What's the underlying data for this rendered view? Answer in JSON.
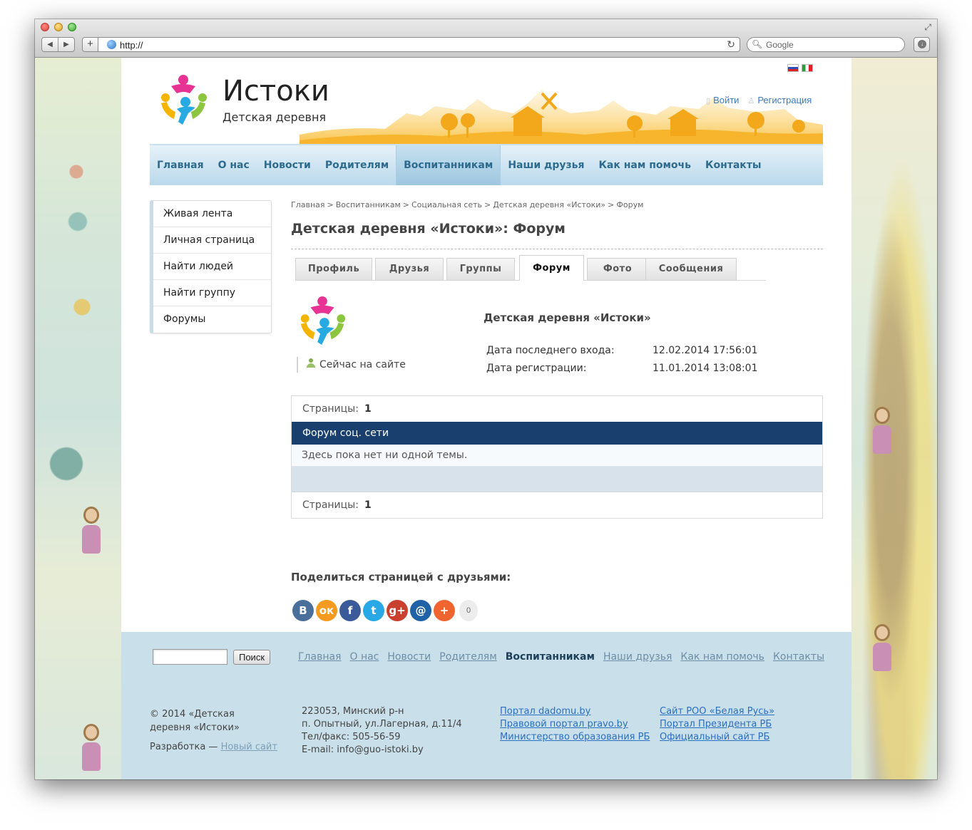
{
  "browser": {
    "url": "http://",
    "search_placeholder": "Google"
  },
  "colors": {
    "nav_text": "#2d6b8f",
    "forum_header_bg": "#183f6d",
    "footer_bg": "#c9dfe9",
    "link": "#2a6fc0"
  },
  "header": {
    "site_name": "Истоки",
    "tagline": "Детская деревня",
    "login": "Войти",
    "register": "Регистрация",
    "languages": [
      "ru",
      "it"
    ]
  },
  "nav": [
    {
      "label": "Главная"
    },
    {
      "label": "О нас"
    },
    {
      "label": "Новости"
    },
    {
      "label": "Родителям"
    },
    {
      "label": "Воспитанникам"
    },
    {
      "label": "Наши друзья"
    },
    {
      "label": "Как нам помочь"
    },
    {
      "label": "Контакты"
    }
  ],
  "nav_active": "Воспитанникам",
  "sidebar": [
    {
      "label": "Живая лента"
    },
    {
      "label": "Личная страница"
    },
    {
      "label": "Найти людей"
    },
    {
      "label": "Найти группу"
    },
    {
      "label": "Форумы"
    }
  ],
  "breadcrumb": [
    "Главная",
    "Воспитанникам",
    "Социальная сеть",
    "Детская деревня «Истоки»",
    "Форум"
  ],
  "breadcrumb_sep": ">",
  "page_title": "Детская деревня «Истоки»: Форум",
  "tabs": [
    {
      "label": "Профиль"
    },
    {
      "label": "Друзья"
    },
    {
      "label": "Группы"
    },
    {
      "label": "Форум"
    },
    {
      "label": "Фото"
    },
    {
      "label": "Сообщения"
    }
  ],
  "tab_active": "Форум",
  "profile": {
    "name": "Детская деревня «Истоки»",
    "online": "Сейчас на сайте",
    "last_login_label": "Дата последнего входа:",
    "last_login_value": "12.02.2014 17:56:01",
    "reg_label": "Дата регистрации:",
    "reg_value": "11.01.2014 13:08:01"
  },
  "forum": {
    "pages_label": "Страницы:",
    "page_number": "1",
    "title": "Форум соц. сети",
    "empty": "Здесь пока нет ни одной темы."
  },
  "share": {
    "title": "Поделиться страницей с друзьями:",
    "buttons": [
      {
        "name": "vkontakte",
        "glyph": "В",
        "color": "#4a6f9a"
      },
      {
        "name": "odnoklassniki",
        "glyph": "ок",
        "color": "#f39a1f"
      },
      {
        "name": "facebook",
        "glyph": "f",
        "color": "#3b5a99"
      },
      {
        "name": "twitter",
        "glyph": "t",
        "color": "#28a8e6"
      },
      {
        "name": "google-plus",
        "glyph": "g+",
        "color": "#c9402f"
      },
      {
        "name": "mail",
        "glyph": "@",
        "color": "#1f63a6"
      },
      {
        "name": "more",
        "glyph": "+",
        "color": "#f0642f"
      }
    ],
    "count": "0"
  },
  "footer": {
    "search_button": "Поиск",
    "nav": [
      "Главная",
      "О нас",
      "Новости",
      "Родителям",
      "Воспитанникам",
      "Наши друзья",
      "Как нам помочь",
      "Контакты"
    ],
    "nav_active": "Воспитанникам",
    "copyright": "© 2014 «Детская деревня «Истоки»",
    "dev_label": "Разработка —",
    "dev_link": "Новый сайт",
    "address": [
      "223053, Минский р-н",
      "п. Опытный, ул.Лагерная, д.11/4",
      "Тел/факс: 505-56-59",
      "E-mail: info@guo-istoki.by"
    ],
    "links1": [
      "Портал dadomu.by",
      "Правовой портал pravo.by",
      "Министерство образования РБ"
    ],
    "links2": [
      "Сайт РОО «Белая Русь»",
      "Портал Президента РБ",
      "Официальный сайт РБ"
    ]
  }
}
